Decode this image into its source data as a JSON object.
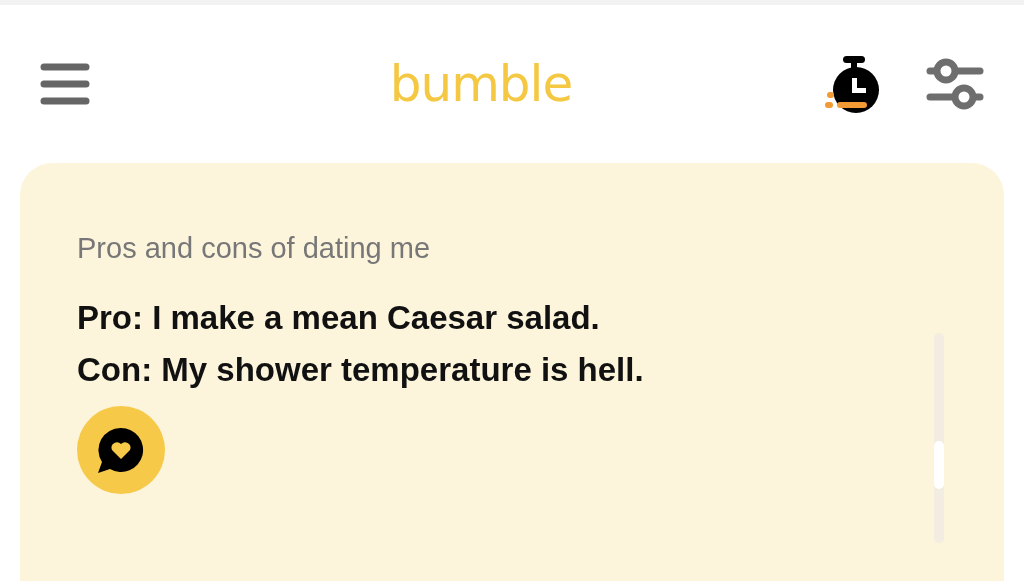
{
  "header": {
    "logo": "bumble"
  },
  "prompt_card": {
    "prompt": "Pros and cons of dating me",
    "answer_lines": [
      "Pro: I make a mean Caesar salad.",
      "Con: My shower temperature is hell."
    ]
  }
}
